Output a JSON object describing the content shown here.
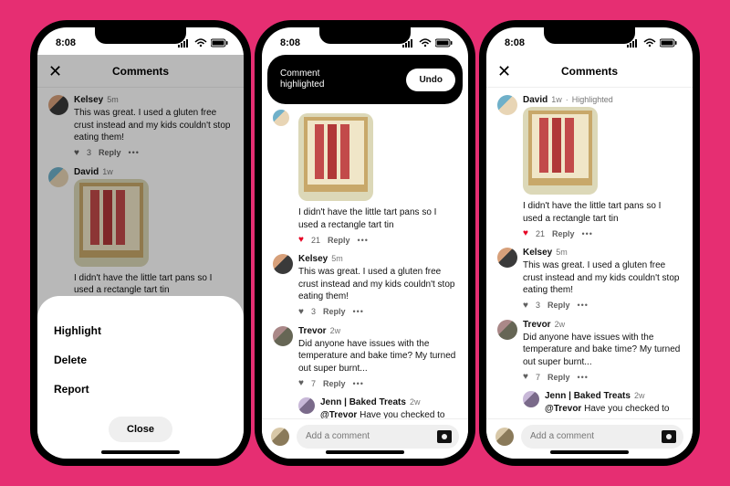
{
  "status_time": "8:08",
  "page_title": "Comments",
  "sheet": {
    "highlight": "Highlight",
    "delete": "Delete",
    "report": "Report",
    "close": "Close"
  },
  "toast": {
    "line1": "Comment",
    "line2": "highlighted",
    "undo": "Undo"
  },
  "highlighted_tag": "Highlighted",
  "reply_label": "Reply",
  "input_placeholder": "Add a comment",
  "comments": {
    "kelsey": {
      "author": "Kelsey",
      "age": "5m",
      "text": "This was great. I used a gluten free crust instead and my kids couldn't stop eating them!",
      "likes": "3"
    },
    "david": {
      "author": "David",
      "age": "1w",
      "text": "I didn't have the little tart pans so I used a rectangle tart tin",
      "likes": "21"
    },
    "trevor": {
      "author": "Trevor",
      "age": "2w",
      "text": "Did anyone have issues with the temperature and bake time? My turned out super burnt...",
      "likes": "7"
    },
    "jenn": {
      "author": "Jenn | Baked Treats",
      "age": "2w",
      "mention": "@Trevor",
      "text": " Have you checked to see"
    }
  }
}
